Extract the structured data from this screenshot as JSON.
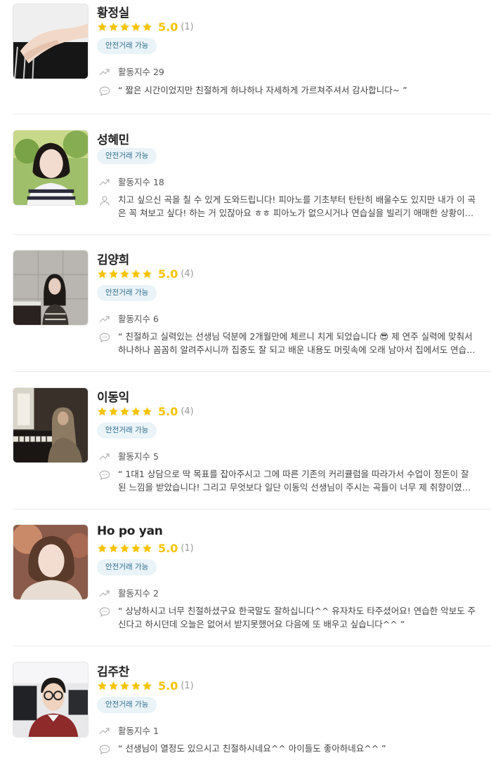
{
  "colors": {
    "star": "#f5c300",
    "badge_bg": "#e9f3f8",
    "badge_text": "#2f6e8f",
    "divider": "#ececec"
  },
  "icons": {
    "activity": "trending-up-icon",
    "review": "chat-bubble-icon",
    "intro": "person-icon",
    "star": "star-icon"
  },
  "teachers": [
    {
      "name": "황정실",
      "score": "5.0",
      "count": "(1)",
      "stars": 5,
      "badge": "안전거래 가능",
      "activity": "활동지수 29",
      "text_kind": "review",
      "text": "“ 짧은 시간이었지만 친절하게 하나하나 자세하게 가르쳐주셔서 감사합니다~ ”"
    },
    {
      "name": "성혜민",
      "score": "",
      "count": "",
      "stars": 0,
      "badge": "안전거래 가능",
      "activity": "활동지수 18",
      "text_kind": "intro",
      "text": "치고 싶으신 곡을 칠 수 있게 도와드립니다! 피아노를 기초부터 탄탄히 배울수도 있지만 내가 이 곡은 꼭 쳐보고 싶다! 하는 거 있잖아요 ㅎㅎ 피아노가 없으시거나 연습실을 빌리기 애매한 상황이라…"
    },
    {
      "name": "김양희",
      "score": "5.0",
      "count": "(4)",
      "stars": 5,
      "badge": "안전거래 가능",
      "activity": "활동지수 6",
      "text_kind": "review",
      "text": "“ 친절하고 실력있는 선생님 덕분에 2개월만에 체르니 치게 되었습니다 😎 제 연주 실력에 맞춰서 하나하나 꼼꼼히 알려주시니까 집중도 잘 되고 배운 내용도 머릿속에 오래 남아서 집에서도 연습…"
    },
    {
      "name": "이동익",
      "score": "5.0",
      "count": "(4)",
      "stars": 5,
      "badge": "안전거래 가능",
      "activity": "활동지수 5",
      "text_kind": "review",
      "text": "“ 1대1 상담으로 딱 목표를 잡아주시고 그에 따른 기존의 커리큘럼을 따라가서 수업이 정돈이 잘 된 느낌을 받았습니다! 그리고 무엇보다 일단 이동익 선생님이 주시는 곡들이 너무 제 취향이였습니…"
    },
    {
      "name": "Ho po yan",
      "score": "5.0",
      "count": "(1)",
      "stars": 5,
      "badge": "안전거래 가능",
      "activity": "활동지수 2",
      "text_kind": "review",
      "text": "“ 상냥하시고 너무 친절하셨구요 한국말도 잘하십니다^^ 유자차도 타주셨어요! 연습한 악보도 주신다고 하시던데 오늘은 없어서 받지못했어요 다음에 또 배우고 싶습니다^^ ”"
    },
    {
      "name": "김주찬",
      "score": "5.0",
      "count": "(1)",
      "stars": 5,
      "badge": "안전거래 가능",
      "activity": "활동지수 1",
      "text_kind": "review",
      "text": "“ 선생님이 열정도 있으시고 친절하시네요^^ 아이들도 좋아하네요^^ ”"
    }
  ]
}
